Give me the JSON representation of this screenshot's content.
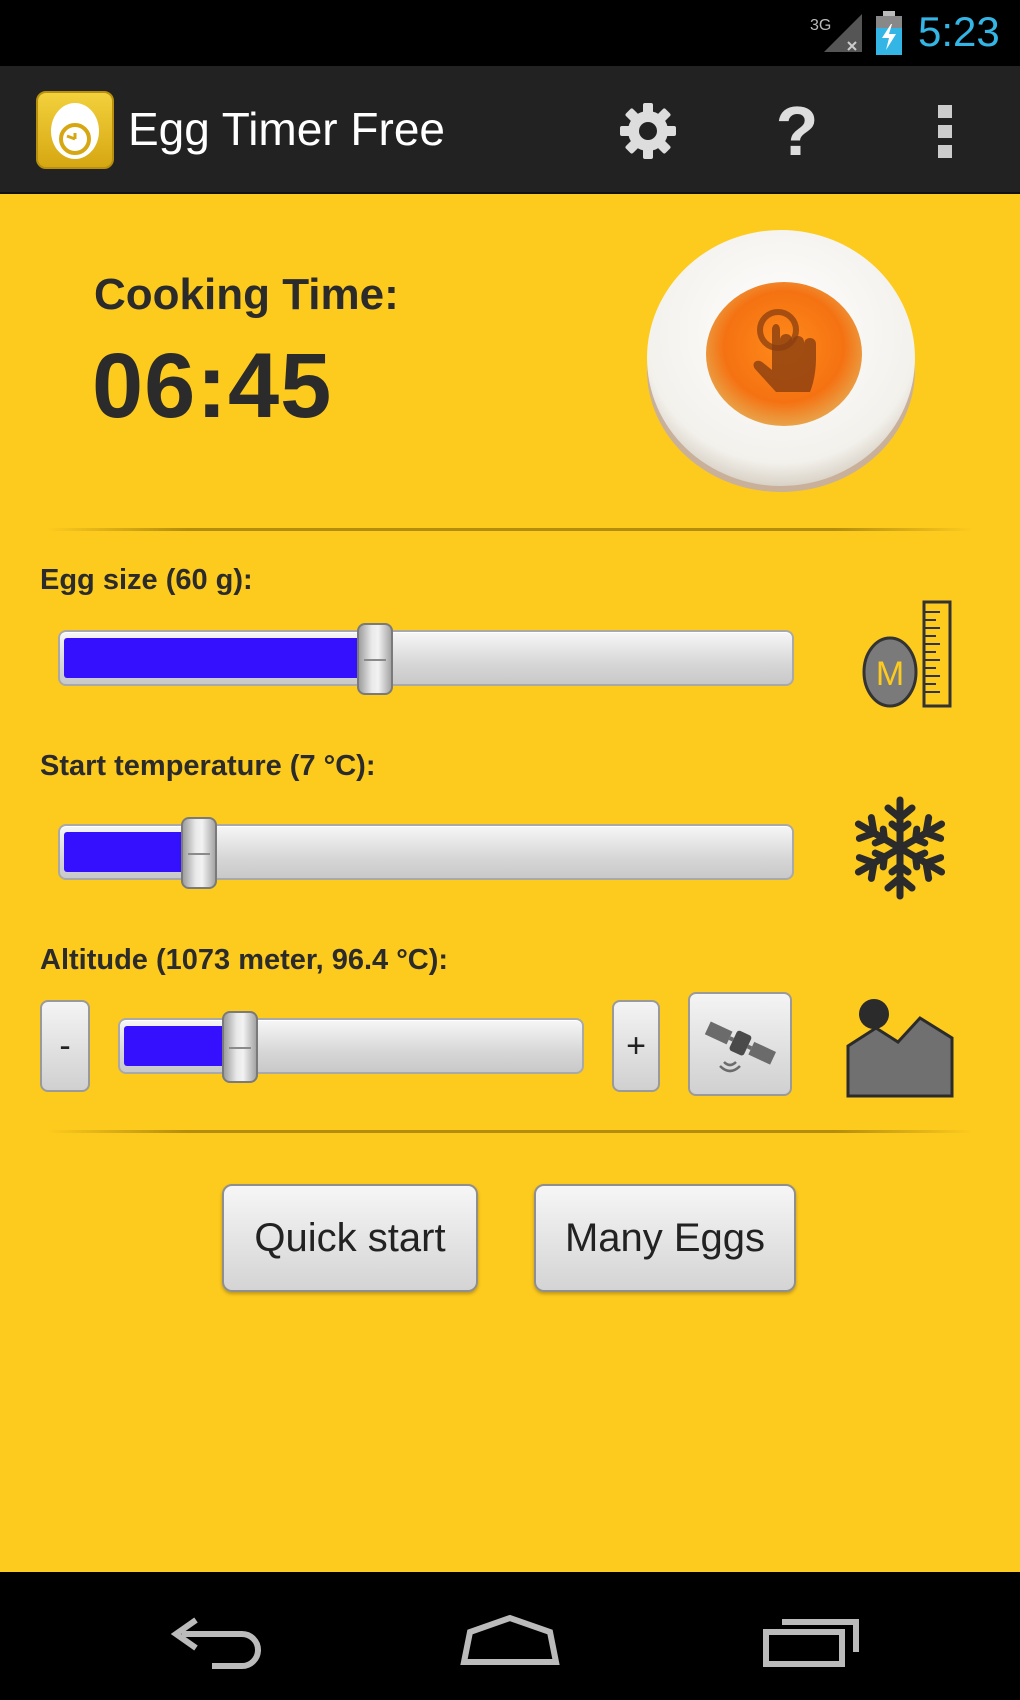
{
  "status_bar": {
    "time": "5:23",
    "network_label": "3G",
    "icons": [
      "signal-3g-icon",
      "battery-charging-icon"
    ]
  },
  "action_bar": {
    "title": "Egg Timer Free",
    "actions": [
      "settings-icon",
      "help-icon",
      "overflow-menu-icon"
    ],
    "help_glyph": "?"
  },
  "cooking": {
    "label": "Cooking Time:",
    "time": "06:45"
  },
  "egg_size": {
    "label": "Egg size (60 g):",
    "value_fraction": 0.43,
    "icon": "egg-size-icon",
    "icon_letter": "M"
  },
  "start_temperature": {
    "label": "Start temperature (7 °C):",
    "value_fraction": 0.19,
    "icon": "snowflake-icon"
  },
  "altitude": {
    "label": "Altitude (1073 meter, 96.4 °C):",
    "value_fraction": 0.26,
    "minus_label": "-",
    "plus_label": "+",
    "gps_icon": "satellite-icon",
    "icon": "mountain-icon"
  },
  "buttons": {
    "quick_start": "Quick start",
    "many_eggs": "Many Eggs"
  },
  "colors": {
    "background": "#fdca1e",
    "slider_fill": "#3510ff",
    "status_text": "#33b5e5"
  },
  "nav_bar": [
    "back-icon",
    "home-icon",
    "recent-apps-icon"
  ]
}
